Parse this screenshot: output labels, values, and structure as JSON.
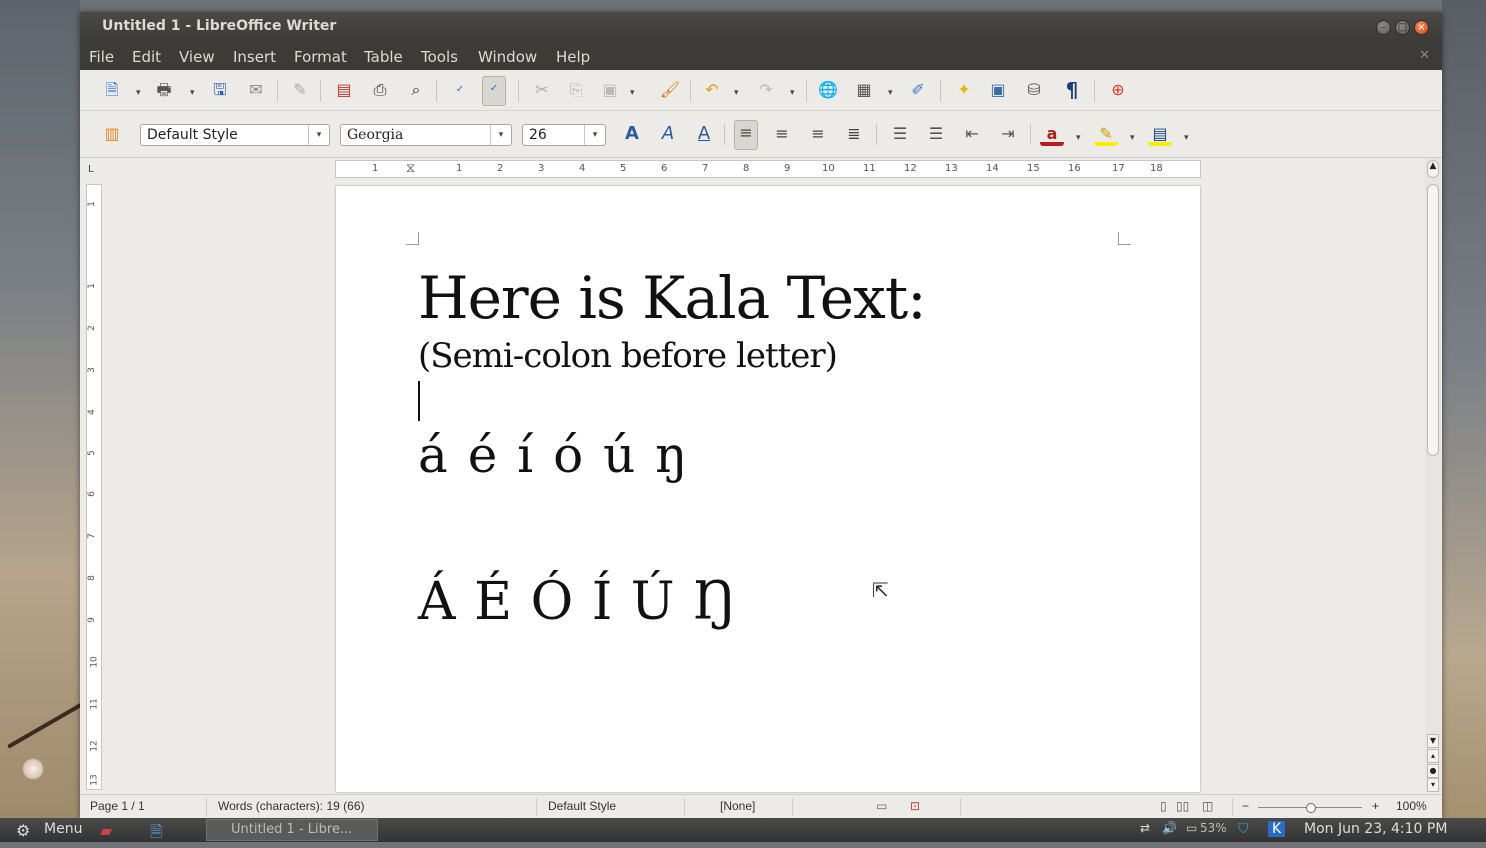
{
  "window": {
    "title": "Untitled 1 - LibreOffice Writer",
    "minimize_glyph": "–",
    "maximize_glyph": "□",
    "close_glyph": "×",
    "doc_close_glyph": "✕"
  },
  "menubar": {
    "items": [
      "File",
      "Edit",
      "View",
      "Insert",
      "Format",
      "Table",
      "Tools",
      "Window",
      "Help"
    ]
  },
  "toolbar_standard": {
    "icons": [
      "new-document-icon",
      "open-icon",
      "save-icon",
      "email-icon",
      "edit-file-icon",
      "export-pdf-icon",
      "print-icon",
      "print-preview-icon",
      "spellcheck-icon",
      "autospellcheck-icon",
      "cut-icon",
      "copy-icon",
      "paste-icon",
      "clone-formatting-icon",
      "undo-icon",
      "redo-icon",
      "hyperlink-icon",
      "table-icon",
      "show-draw-functions-icon",
      "navigator-icon",
      "gallery-icon",
      "data-sources-icon",
      "formatting-marks-icon",
      "help-icon"
    ]
  },
  "toolbar_formatting": {
    "paragraph_style": "Default Style",
    "font_name": "Georgia",
    "font_size": "26",
    "icons": [
      "styles-and-formatting-icon",
      "bold-icon",
      "italic-icon",
      "underline-icon",
      "align-left-icon",
      "align-center-icon",
      "align-right-icon",
      "justify-icon",
      "numbering-icon",
      "bullets-icon",
      "decrease-indent-icon",
      "increase-indent-icon",
      "font-color-icon",
      "highlighting-icon",
      "background-color-icon"
    ]
  },
  "ruler": {
    "ticks": [
      "1",
      "1",
      "2",
      "3",
      "4",
      "5",
      "6",
      "7",
      "8",
      "9",
      "10",
      "11",
      "12",
      "13",
      "14",
      "15",
      "16",
      "17",
      "18"
    ],
    "corner": "L"
  },
  "vertical_ruler": {
    "ticks": [
      "1",
      "1",
      "2",
      "3",
      "4",
      "5",
      "6",
      "7",
      "8",
      "9",
      "10",
      "11",
      "12",
      "13"
    ]
  },
  "document": {
    "heading": "Here is Kala Text:",
    "subheading": "(Semi-colon before letter)",
    "lowercase_line": "á é í ó ú ŋ",
    "uppercase_line": "Á É Ó Í Ú Ŋ"
  },
  "statusbar": {
    "page": "Page 1 / 1",
    "words": "Words (characters): 19 (66)",
    "style": "Default Style",
    "language": "[None]",
    "zoom": "100%",
    "zoom_minus": "−",
    "zoom_plus": "+"
  },
  "taskbar": {
    "menu_label": "Menu",
    "task_item": "Untitled 1 - Libre...",
    "battery": "53%",
    "clock": "Mon Jun 23,  4:10 PM"
  },
  "colors": {
    "titlebar": "#3c3b37",
    "close_button": "#e2561f",
    "page": "#ffffff",
    "chrome": "#ecebe8"
  }
}
